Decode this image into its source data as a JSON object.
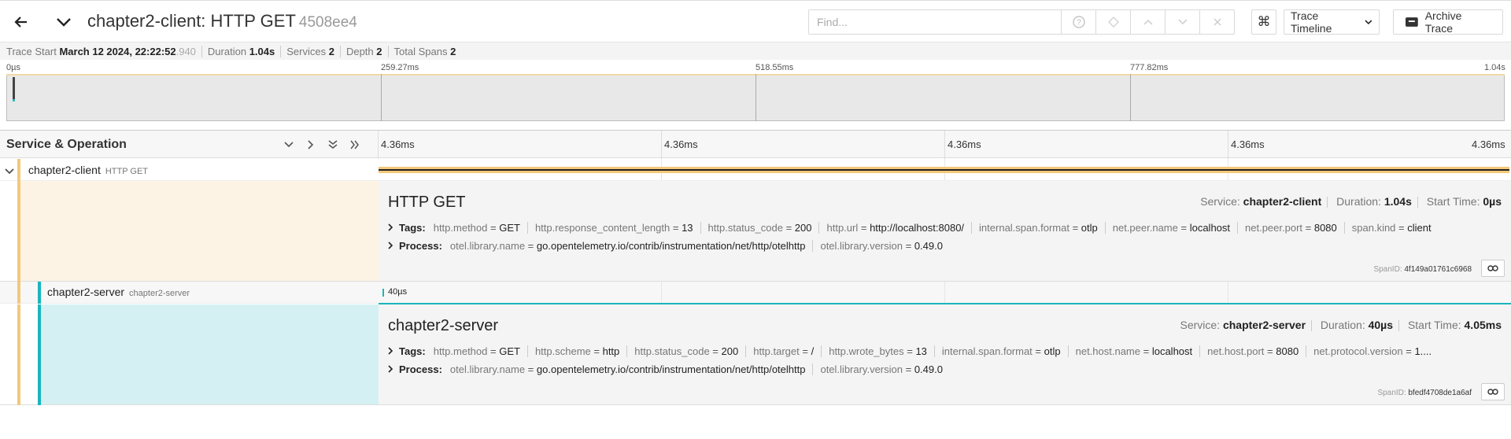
{
  "header": {
    "title": "chapter2-client: HTTP GET",
    "trace_id": "4508ee4",
    "find_placeholder": "Find...",
    "view_label": "Trace Timeline",
    "archive_label": "Archive Trace"
  },
  "summary": {
    "trace_start_label": "Trace Start",
    "trace_start_value": "March 12 2024, 22:22:52",
    "trace_start_ms": ".940",
    "duration_label": "Duration",
    "duration_value": "1.04s",
    "services_label": "Services",
    "services_value": "2",
    "depth_label": "Depth",
    "depth_value": "2",
    "total_spans_label": "Total Spans",
    "total_spans_value": "2"
  },
  "minimap": {
    "ticks": [
      "0µs",
      "259.27ms",
      "518.55ms",
      "777.82ms",
      "1.04s"
    ]
  },
  "timeline": {
    "column_title": "Service & Operation",
    "ticks": [
      "4.36ms",
      "4.36ms",
      "4.36ms",
      "4.36ms",
      "4.36ms"
    ]
  },
  "spans": [
    {
      "service": "chapter2-client",
      "operation": "HTTP GET",
      "title": "HTTP GET",
      "meta": {
        "service_label": "Service:",
        "service_value": "chapter2-client",
        "duration_label": "Duration:",
        "duration_value": "1.04s",
        "start_label": "Start Time:",
        "start_value": "0µs"
      },
      "tags_label": "Tags:",
      "tags": [
        {
          "k": "http.method",
          "v": "GET"
        },
        {
          "k": "http.response_content_length",
          "v": "13"
        },
        {
          "k": "http.status_code",
          "v": "200"
        },
        {
          "k": "http.url",
          "v": "http://localhost:8080/"
        },
        {
          "k": "internal.span.format",
          "v": "otlp"
        },
        {
          "k": "net.peer.name",
          "v": "localhost"
        },
        {
          "k": "net.peer.port",
          "v": "8080"
        },
        {
          "k": "span.kind",
          "v": "client"
        }
      ],
      "process_label": "Process:",
      "process": [
        {
          "k": "otel.library.name",
          "v": "go.opentelemetry.io/contrib/instrumentation/net/http/otelhttp"
        },
        {
          "k": "otel.library.version",
          "v": "0.49.0"
        }
      ],
      "span_id_label": "SpanID:",
      "span_id": "4f149a01761c6968"
    },
    {
      "service": "chapter2-server",
      "operation": "chapter2-server",
      "bar_label": "40µs",
      "title": "chapter2-server",
      "meta": {
        "service_label": "Service:",
        "service_value": "chapter2-server",
        "duration_label": "Duration:",
        "duration_value": "40µs",
        "start_label": "Start Time:",
        "start_value": "4.05ms"
      },
      "tags_label": "Tags:",
      "tags": [
        {
          "k": "http.method",
          "v": "GET"
        },
        {
          "k": "http.scheme",
          "v": "http"
        },
        {
          "k": "http.status_code",
          "v": "200"
        },
        {
          "k": "http.target",
          "v": "/"
        },
        {
          "k": "http.wrote_bytes",
          "v": "13"
        },
        {
          "k": "internal.span.format",
          "v": "otlp"
        },
        {
          "k": "net.host.name",
          "v": "localhost"
        },
        {
          "k": "net.host.port",
          "v": "8080"
        },
        {
          "k": "net.protocol.version",
          "v": "1...."
        }
      ],
      "process_label": "Process:",
      "process": [
        {
          "k": "otel.library.name",
          "v": "go.opentelemetry.io/contrib/instrumentation/net/http/otelhttp"
        },
        {
          "k": "otel.library.version",
          "v": "0.49.0"
        }
      ],
      "span_id_label": "SpanID:",
      "span_id": "bfedf4708de1a6af"
    }
  ],
  "colors": {
    "client": "#f3c87a",
    "client_bg": "#fdf3e4",
    "server": "#1ab5bd",
    "server_bg": "#d5f0f2"
  }
}
